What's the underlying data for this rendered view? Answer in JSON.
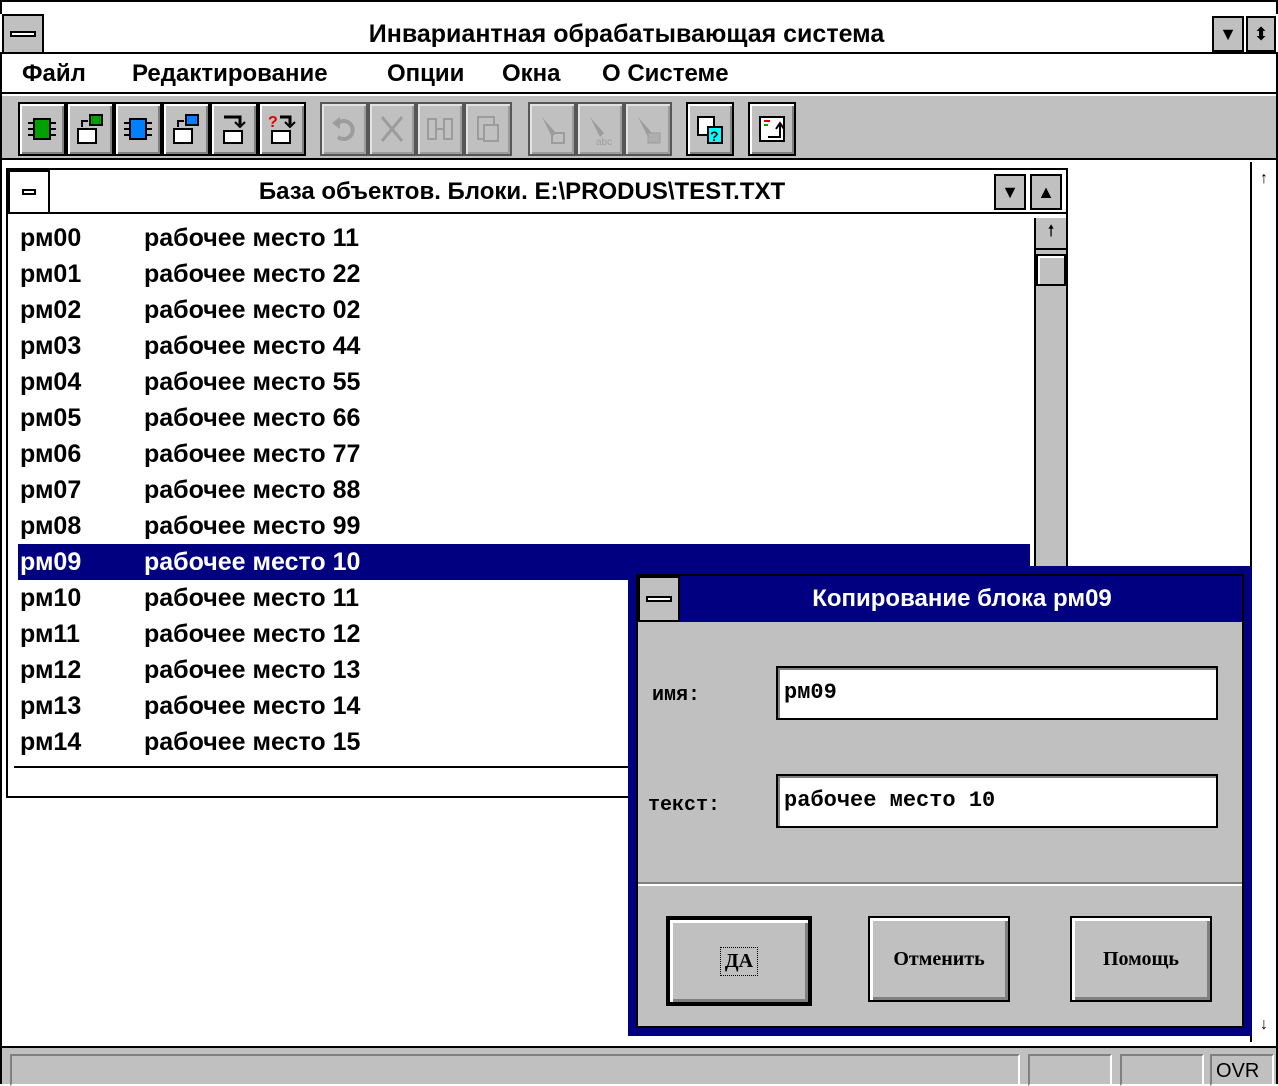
{
  "app": {
    "title": "Инвариантная обрабатывающая система"
  },
  "menu": [
    "Файл",
    "Редактирование",
    "Опции",
    "Окна",
    "О Системе"
  ],
  "toolbar_icons": [
    "block-green-icon",
    "copy-green-icon",
    "block-blue-icon",
    "copy-blue-icon",
    "insert-icon",
    "insert-query-icon",
    "undo-icon",
    "cut-icon",
    "split-icon",
    "paste-icon",
    "pen-icon",
    "pen-abc-icon",
    "pen-grid-icon",
    "help-icon",
    "refresh-icon"
  ],
  "doc_window": {
    "title": "База объектов. Блоки. E:\\PRODUS\\TEST.TXT",
    "rows": [
      {
        "code": "рм00",
        "text": "рабочее место 11"
      },
      {
        "code": "рм01",
        "text": "рабочее место 22"
      },
      {
        "code": "рм02",
        "text": "рабочее место 02"
      },
      {
        "code": "рм03",
        "text": "рабочее место 44"
      },
      {
        "code": "рм04",
        "text": "рабочее место 55"
      },
      {
        "code": "рм05",
        "text": "рабочее место 66"
      },
      {
        "code": "рм06",
        "text": "рабочее место 77"
      },
      {
        "code": "рм07",
        "text": "рабочее место 88"
      },
      {
        "code": "рм08",
        "text": "рабочее место 99"
      },
      {
        "code": "рм09",
        "text": "рабочее место 10"
      },
      {
        "code": "рм10",
        "text": "рабочее место 11"
      },
      {
        "code": "рм11",
        "text": "рабочее место 12"
      },
      {
        "code": "рм12",
        "text": "рабочее место 13"
      },
      {
        "code": "рм13",
        "text": "рабочее место 14"
      },
      {
        "code": "рм14",
        "text": "рабочее место 15"
      }
    ],
    "selected_index": 9
  },
  "dialog": {
    "title": "Копирование блока рм09",
    "name_label": "имя:",
    "name_value": "рм09",
    "text_label": "текст:",
    "text_value": "рабочее место 10",
    "ok_label": "ДА",
    "cancel_label": "Отменить",
    "help_label": "Помощь"
  },
  "status": {
    "ovr": "OVR"
  },
  "colors": {
    "selection": "#000080",
    "dialog_title": "#000080",
    "face": "#c0c0c0"
  }
}
